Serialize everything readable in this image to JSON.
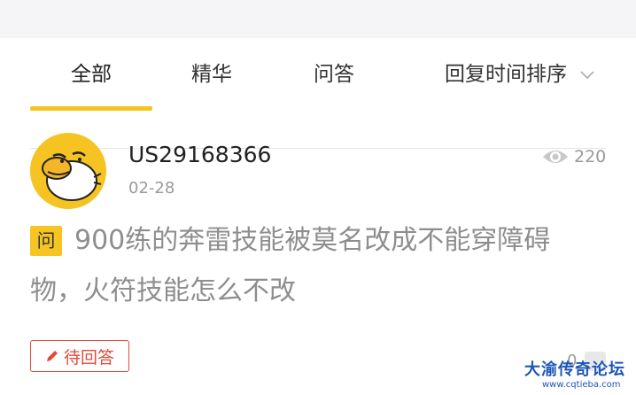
{
  "tabs": {
    "all": "全部",
    "featured": "精华",
    "qa": "问答",
    "sort": "回复时间排序",
    "active": "全部"
  },
  "post": {
    "username": "US29168366",
    "date": "02-28",
    "views": "220",
    "badge": "问",
    "title_line1": "900练的奔雷技能被莫名改成不能穿障碍",
    "title_line2": "物，火符技能怎么不改",
    "status_label": "待回答",
    "reply_count": "0"
  },
  "watermark": {
    "title": "大渝传奇论坛",
    "url": "www.cqtieba.com"
  },
  "colors": {
    "accent": "#f4c51e",
    "status_red": "#e24a3a",
    "muted_text": "#9a9a9a",
    "watermark_blue": "#1c56b8"
  },
  "icons": [
    "chevron-down-icon",
    "eye-icon",
    "pencil-icon",
    "reply-icon",
    "duck-avatar"
  ]
}
